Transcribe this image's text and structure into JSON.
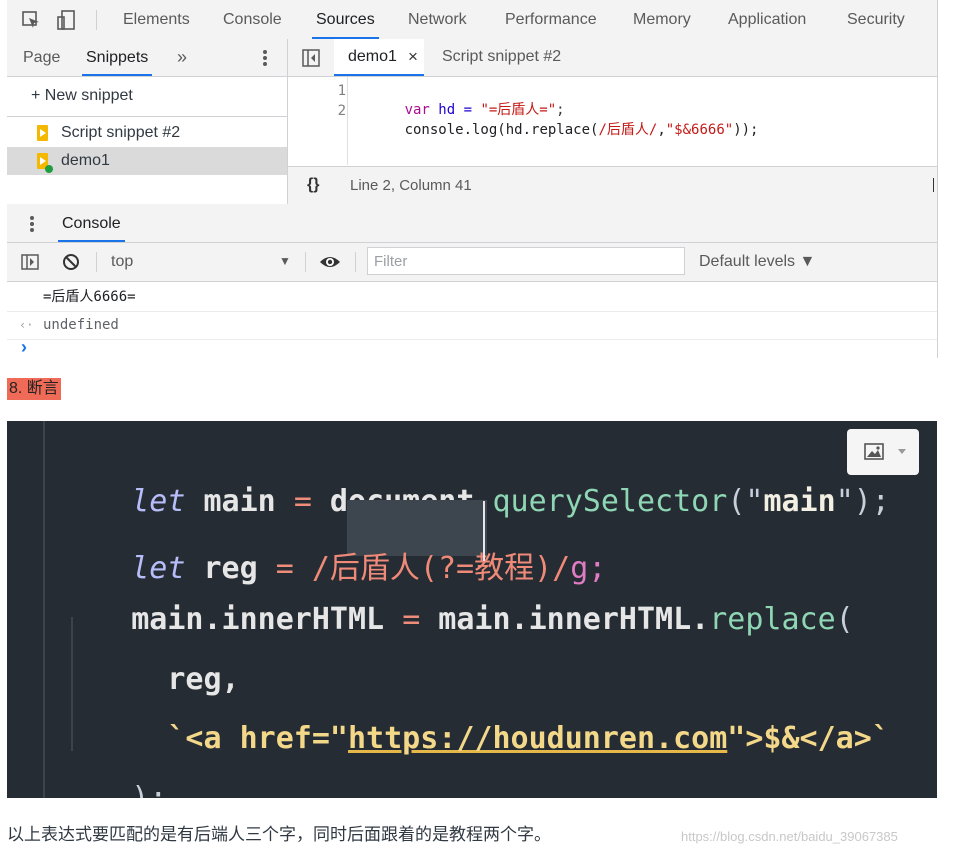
{
  "devtools": {
    "tabs": [
      "Elements",
      "Console",
      "Sources",
      "Network",
      "Performance",
      "Memory",
      "Application",
      "Security"
    ],
    "active_tab": "Sources",
    "nav_tabs": {
      "page": "Page",
      "snippets": "Snippets",
      "more": "»"
    },
    "new_snippet": "+ New snippet",
    "snippets": [
      "Script snippet #2",
      "demo1"
    ],
    "editor_tabs": {
      "active": "demo1",
      "close": "×",
      "other": "Script snippet #2"
    },
    "code_lines": [
      {
        "num": "1",
        "kw": "var",
        "rest_a": " hd = ",
        "str": "\"=后盾人=\"",
        "rest_b": ";"
      },
      {
        "num": "2",
        "a": "console.log(hd.replace(",
        "rx": "/后盾人/",
        "b": ",",
        "str": "\"$&6666\"",
        "c": "));"
      }
    ],
    "status": {
      "braces": "{}",
      "position": "Line 2, Column 41"
    },
    "drawer": {
      "menu": "⋮",
      "tab": "Console"
    },
    "console_toolbar": {
      "context": "top",
      "dropdown": "▼",
      "filter_placeholder": "Filter",
      "levels": "Default levels ▼"
    },
    "console_lines": [
      "=后盾人6666=",
      "undefined"
    ],
    "result_arrow": "‹·",
    "prompt": "›"
  },
  "heading": "8. 断言",
  "code_image": {
    "lines": [
      {
        "kw": "let",
        "a": " main ",
        "eq": "=",
        "b": " document.",
        "fn": "querySelector",
        "c": "(\"",
        "s": "main",
        "d": "\");"
      },
      {
        "kw": "let",
        "a": " reg ",
        "eq": "=",
        "rx": " /后盾人(?=教程)/",
        "g": "g;"
      },
      {
        "a": "main.innerHTML ",
        "eq": "=",
        "b": " main.innerHTML.",
        "fn": "replace",
        "c": "("
      },
      {
        "a": "  reg,"
      },
      {
        "a": "  `<a href=\"",
        "s": "https://houdunren.com",
        "b": "\">$&</a>`"
      },
      {
        "a": ");"
      }
    ]
  },
  "caption": "以上表达式要匹配的是有后端人三个字，同时后面跟着的是教程两个字。",
  "watermark": "https://blog.csdn.net/baidu_39067385",
  "colors": {
    "accent": "#1a73e8",
    "heading_bg": "#ef6b57",
    "code_bg": "#252c33"
  }
}
